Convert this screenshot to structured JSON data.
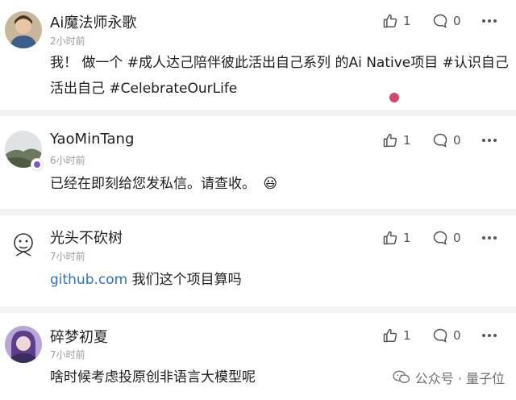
{
  "comments": [
    {
      "username": "Ai魔法师永歌",
      "time": "2小时前",
      "text": "我！ 做一个 #成人达己陪伴彼此活出自己系列 的Ai Native项目 #认识自己活出自己 #CelebrateOurLife",
      "likes": "1",
      "replies": "0"
    },
    {
      "username": "YaoMinTang",
      "time": "6小时前",
      "text": "已经在即刻给您发私信。请查收。",
      "emoji": "😃",
      "likes": "1",
      "replies": "0"
    },
    {
      "username": "光头不砍树",
      "time": "7小时前",
      "link": "github.com",
      "text": " 我们这个项目算吗",
      "likes": "1",
      "replies": "0"
    },
    {
      "username": "碎梦初夏",
      "time": "7小时前",
      "text": "啥时候考虑投原创非语言大模型呢",
      "likes": "1",
      "replies": "0"
    }
  ],
  "watermark": "公众号 · 量子位",
  "icons": {
    "like": "thumbs-up-icon",
    "reply": "comment-bubble-icon",
    "more": "more-dots-icon",
    "watermark": "wechat-icon"
  },
  "colors": {
    "link": "#2f72c7",
    "badge": "#7b5cc4",
    "dot": "#d9446a"
  }
}
